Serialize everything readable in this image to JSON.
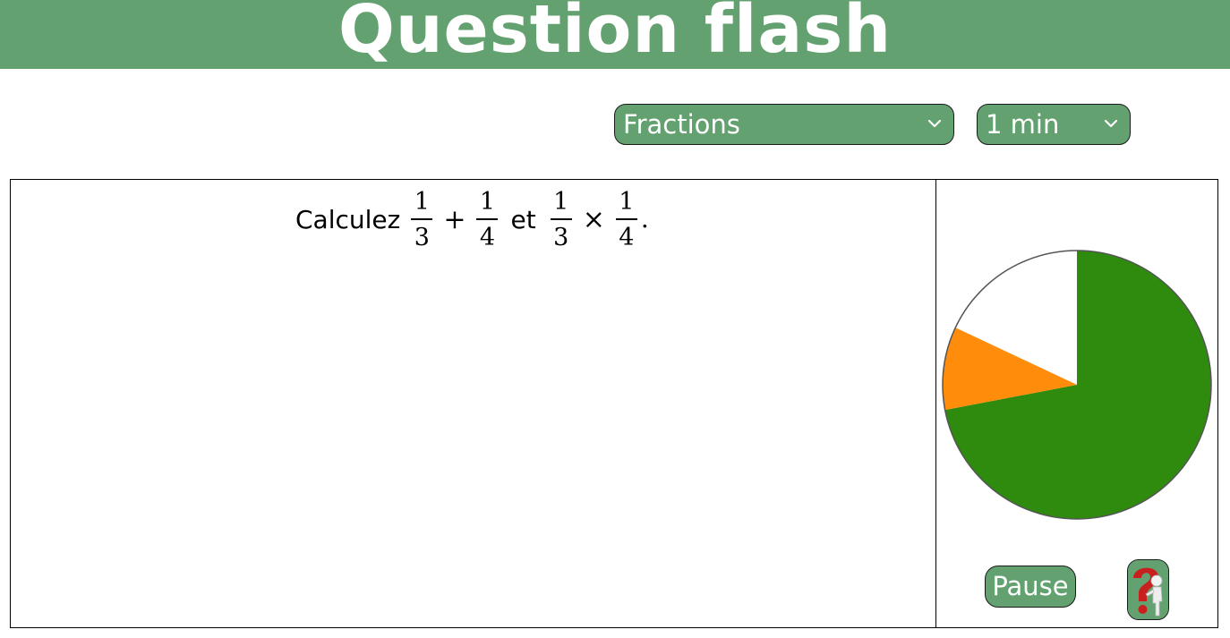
{
  "header": {
    "title": "Question flash"
  },
  "controls": {
    "theme_select": {
      "selected": "Fractions"
    },
    "duration_select": {
      "selected": "1 min"
    }
  },
  "question": {
    "prefix": "Calculez",
    "connector": "et",
    "terms": [
      {
        "numerator": "1",
        "denominator": "3"
      },
      {
        "operator": "+"
      },
      {
        "numerator": "1",
        "denominator": "4"
      },
      {
        "numerator": "1",
        "denominator": "3"
      },
      {
        "operator": "×"
      },
      {
        "numerator": "1",
        "denominator": "4"
      }
    ],
    "final_punctuation": "."
  },
  "timer": {
    "remaining_fraction": 0.82,
    "warning_fraction": 0.1,
    "colors": {
      "remaining": "#2e8b0e",
      "warning": "#ff8c0a",
      "elapsed": "#ffffff",
      "outline": "#555555"
    }
  },
  "actions": {
    "pause_label": "Pause",
    "help_icon": "question-mark-figure-icon"
  },
  "theme": {
    "accent": "#64a170",
    "text_on_accent": "#ffffff"
  }
}
